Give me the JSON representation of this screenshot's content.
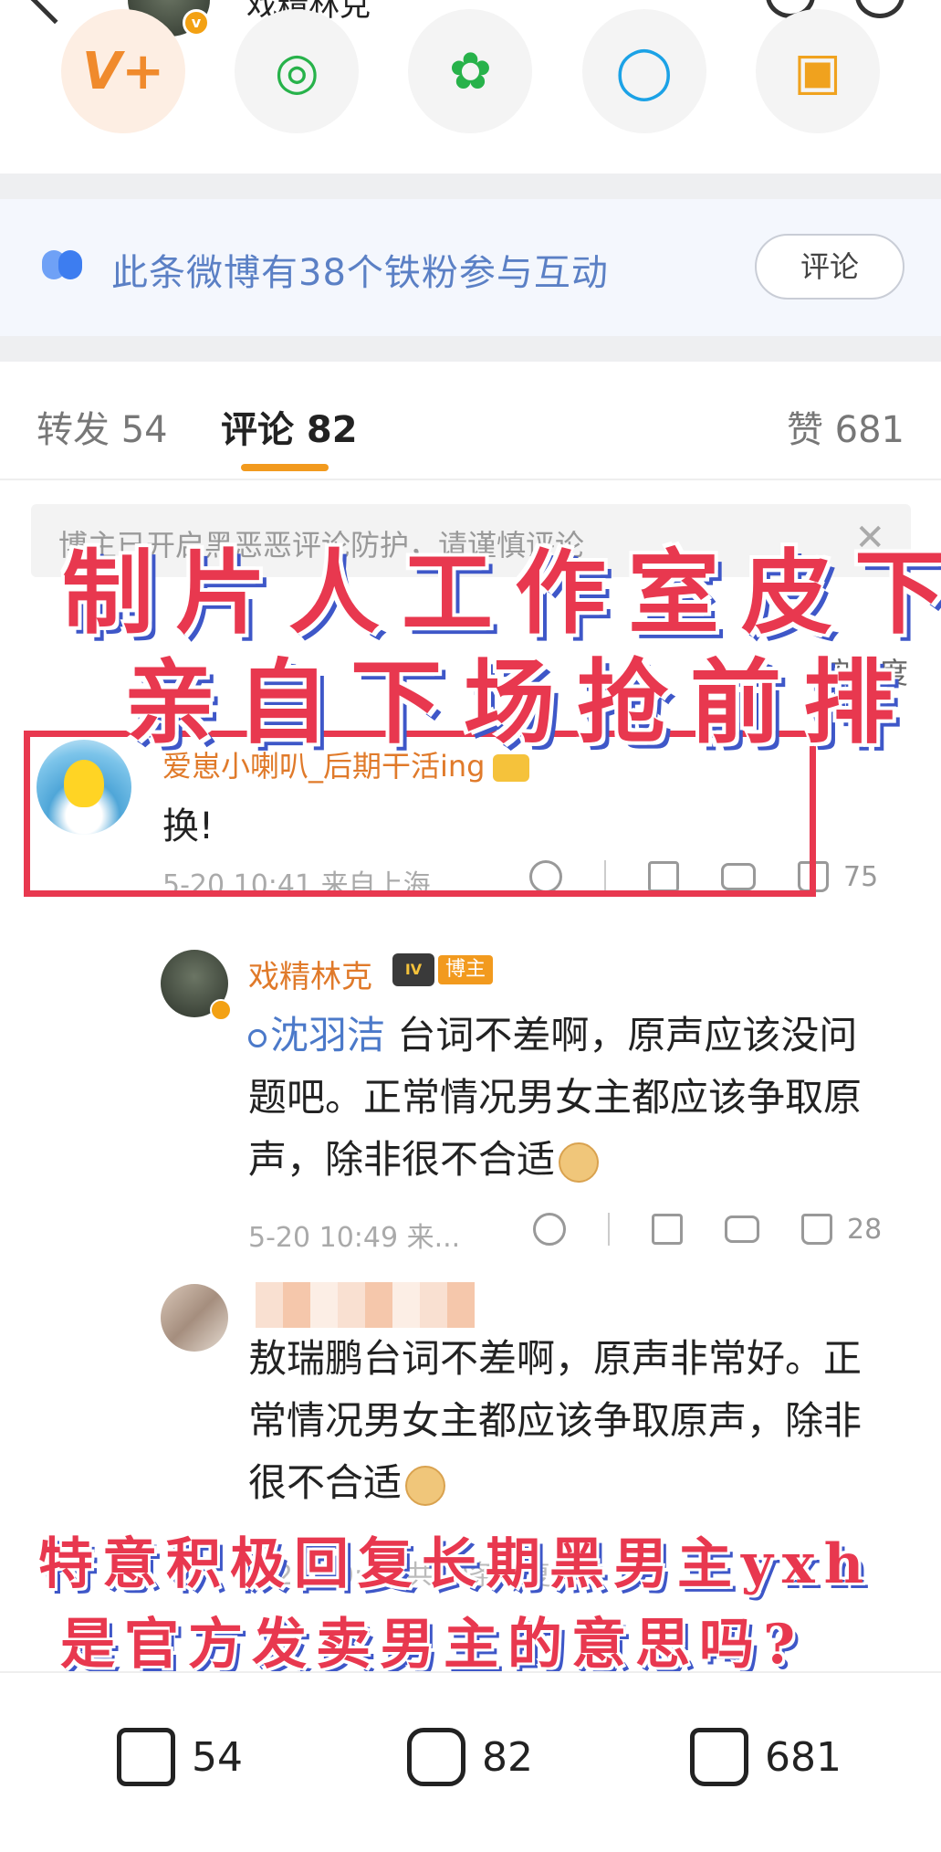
{
  "header": {
    "username": "戏精林克"
  },
  "share_row": {
    "items": [
      {
        "icon": "weibo-vip-icon"
      },
      {
        "icon": "wechat-icon"
      },
      {
        "icon": "moments-icon"
      },
      {
        "icon": "qq-icon"
      },
      {
        "icon": "save-image-icon"
      }
    ]
  },
  "banner": {
    "text": "此条微博有38个铁粉参与互动",
    "button": "评论"
  },
  "tabs": {
    "repost": "转发 54",
    "comment": "评论 82",
    "likes": "赞 681"
  },
  "notice": {
    "text": "博主已开启黑恶恶评论防护，请谨慎评论",
    "close": "✕"
  },
  "sort_label": "按热度",
  "captions": {
    "top_line1": "制片人工作室皮下",
    "top_line2": "亲自下场抢前排",
    "bottom_line1": "特意积极回复长期黑男主yxh",
    "bottom_line2": "是官方发卖男主的意思吗?"
  },
  "comments": [
    {
      "user": "爱崽小喇叭_后期干活ing",
      "text": "换!",
      "meta": "5-20 10:41  来自上海",
      "likes": "75"
    }
  ],
  "replies": [
    {
      "user": "戏精林克",
      "badge": "博主",
      "level": "IV",
      "mention": "沈羽洁",
      "text": " 台词不差啊，原声应该没问题吧。正常情况男女主都应该争取原声，除非很不合适",
      "meta": "5-20 10:49  来...",
      "likes": "28"
    },
    {
      "text": "敖瑞鹏台词不差啊，原声非常好。正常情况男女主都应该争取原声，除非很不合适",
      "meta_ghost": "5-20 10:53  共10条回复 >"
    }
  ],
  "bottom_bar": {
    "repost": "54",
    "comment": "82",
    "like": "681"
  }
}
